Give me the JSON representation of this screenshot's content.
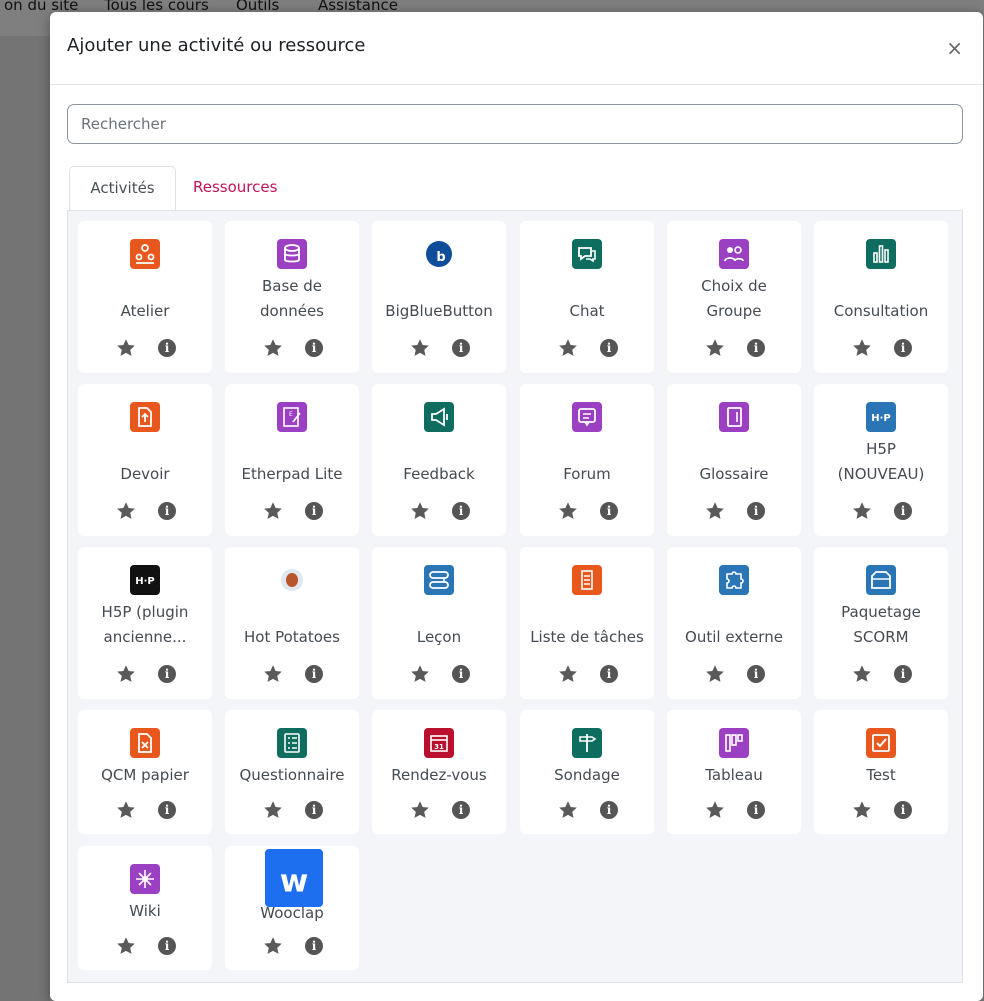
{
  "nav": {
    "items": [
      "on du site",
      "Tous les cours",
      "Outils",
      "Assistance"
    ]
  },
  "modal": {
    "title": "Ajouter une activité ou ressource",
    "close_label": "×",
    "search_placeholder": "Rechercher",
    "tabs": [
      {
        "label": "Activités",
        "active": true
      },
      {
        "label": "Ressources",
        "active": false
      }
    ],
    "info_glyph": "i"
  },
  "colors": {
    "orange": "#e8571e",
    "purple": "#9b3fc3",
    "blue": "#2a75b5",
    "teal": "#0e6d5f",
    "darkred": "#b8102e",
    "link": "#c0145a"
  },
  "activities": [
    {
      "lines": [
        "Atelier"
      ],
      "icon": "atelier-icon",
      "color": "#e8571e"
    },
    {
      "lines": [
        "Base de",
        "données"
      ],
      "icon": "database-icon",
      "color": "#9b3fc3"
    },
    {
      "lines": [
        "BigBlueButton"
      ],
      "icon": "bigbluebutton-icon",
      "color": "#0f4c9a"
    },
    {
      "lines": [
        "Chat"
      ],
      "icon": "chat-icon",
      "color": "#0e6d5f"
    },
    {
      "lines": [
        "Choix de",
        "Groupe"
      ],
      "icon": "group-choice-icon",
      "color": "#9b3fc3"
    },
    {
      "lines": [
        "Consultation"
      ],
      "icon": "bar-chart-icon",
      "color": "#0e6d5f"
    },
    {
      "lines": [
        "Devoir"
      ],
      "icon": "assignment-icon",
      "color": "#e8571e"
    },
    {
      "lines": [
        "Etherpad Lite"
      ],
      "icon": "etherpad-icon",
      "color": "#9b3fc3"
    },
    {
      "lines": [
        "Feedback"
      ],
      "icon": "megaphone-icon",
      "color": "#0e6d5f"
    },
    {
      "lines": [
        "Forum"
      ],
      "icon": "forum-icon",
      "color": "#9b3fc3"
    },
    {
      "lines": [
        "Glossaire"
      ],
      "icon": "book-icon",
      "color": "#9b3fc3"
    },
    {
      "lines": [
        "H5P",
        "(NOUVEAU)"
      ],
      "icon": "h5p-icon",
      "color": "#2a75b5"
    },
    {
      "lines": [
        "H5P (plugin",
        "ancienne..."
      ],
      "icon": "h5p-legacy-icon",
      "color": "#111111"
    },
    {
      "lines": [
        "Hot Potatoes"
      ],
      "icon": "hot-potatoes-icon",
      "color": "#c46a3a"
    },
    {
      "lines": [
        "Leçon"
      ],
      "icon": "lesson-icon",
      "color": "#2a75b5"
    },
    {
      "lines": [
        "Liste de tâches"
      ],
      "icon": "checklist-icon",
      "color": "#e8571e"
    },
    {
      "lines": [
        "Outil externe"
      ],
      "icon": "puzzle-icon",
      "color": "#2a75b5"
    },
    {
      "lines": [
        "Paquetage",
        "SCORM"
      ],
      "icon": "package-icon",
      "color": "#2a75b5"
    },
    {
      "lines": [
        "QCM papier"
      ],
      "icon": "paper-quiz-icon",
      "color": "#e8571e"
    },
    {
      "lines": [
        "Questionnaire"
      ],
      "icon": "questionnaire-icon",
      "color": "#0e6d5f"
    },
    {
      "lines": [
        "Rendez-vous"
      ],
      "icon": "calendar-icon",
      "color": "#b8102e"
    },
    {
      "lines": [
        "Sondage"
      ],
      "icon": "signpost-icon",
      "color": "#0e6d5f"
    },
    {
      "lines": [
        "Tableau"
      ],
      "icon": "board-icon",
      "color": "#9b3fc3"
    },
    {
      "lines": [
        "Test"
      ],
      "icon": "quiz-check-icon",
      "color": "#e8571e"
    },
    {
      "lines": [
        "Wiki"
      ],
      "icon": "wiki-icon",
      "color": "#9b3fc3"
    },
    {
      "lines": [
        "Wooclap"
      ],
      "icon": "wooclap-icon",
      "color": "#1e6ef0"
    }
  ]
}
